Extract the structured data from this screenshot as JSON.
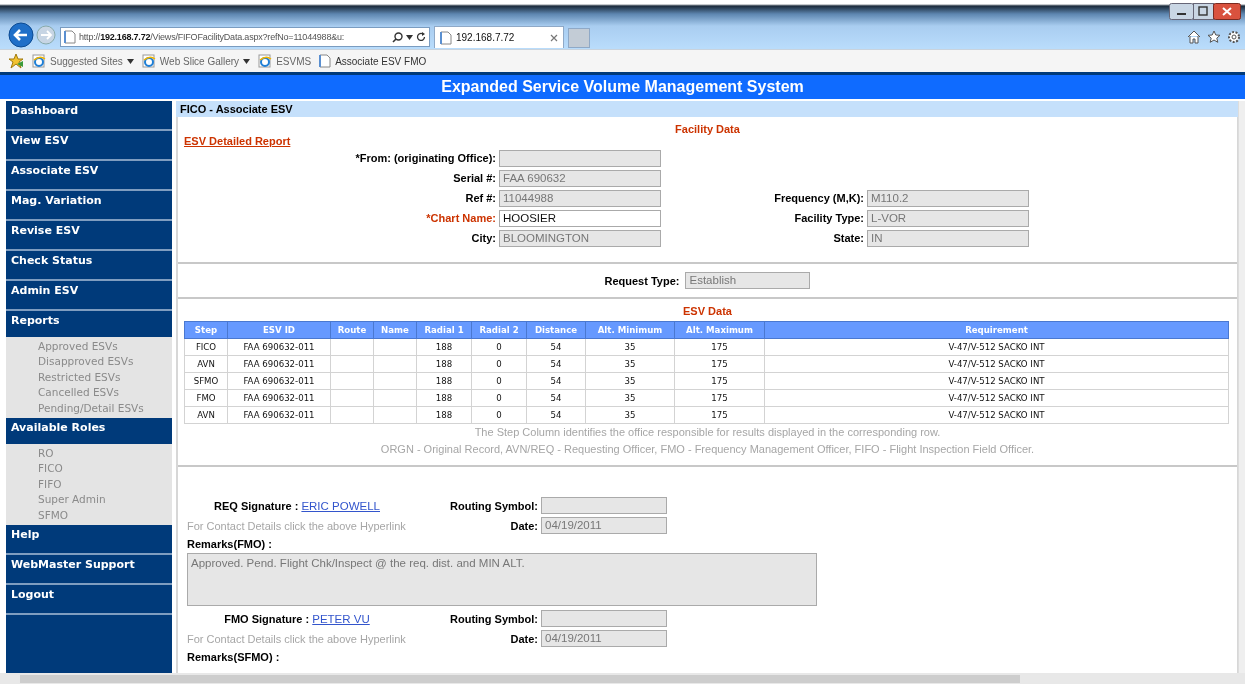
{
  "browser": {
    "address": "http://**192.168.7.72**/Views/FIFOFacilityData.aspx?refNo=11044988&u:",
    "tab_title": "192.168.7.72",
    "favorites": [
      {
        "label": "Suggested Sites",
        "kind": "ie",
        "dropdown": true
      },
      {
        "label": "Web Slice Gallery",
        "kind": "ie",
        "dropdown": true
      },
      {
        "label": "ESVMS",
        "kind": "ie",
        "dropdown": false
      },
      {
        "label": "Associate ESV FMO",
        "kind": "page",
        "dropdown": false
      }
    ]
  },
  "header": {
    "title": "Expanded Service Volume Management System"
  },
  "sidebar": {
    "items": [
      {
        "label": "Dashboard"
      },
      {
        "label": "View ESV"
      },
      {
        "label": "Associate ESV"
      },
      {
        "label": "Mag. Variation"
      },
      {
        "label": "Revise ESV"
      },
      {
        "label": "Check Status"
      },
      {
        "label": "Admin ESV"
      },
      {
        "label": "Reports",
        "children": [
          {
            "label": "Approved ESVs"
          },
          {
            "label": "Disapproved ESVs"
          },
          {
            "label": "Restricted ESVs"
          },
          {
            "label": "Cancelled ESVs"
          },
          {
            "label": "Pending/Detail ESVs"
          }
        ]
      },
      {
        "label": "Available Roles",
        "children": [
          {
            "label": "RO"
          },
          {
            "label": "FICO"
          },
          {
            "label": "FIFO"
          },
          {
            "label": "Super Admin"
          },
          {
            "label": "SFMO"
          }
        ]
      },
      {
        "label": "Help"
      },
      {
        "label": "WebMaster Support"
      },
      {
        "label": "Logout"
      }
    ]
  },
  "page_title": "FICO - Associate ESV",
  "facility": {
    "heading": "Facility Data",
    "report_link": "ESV Detailed Report",
    "left_fields": [
      {
        "label": "*From: (originating Office):",
        "kind": "readonly"
      },
      {
        "label": "Serial #:",
        "value": "FAA 690632",
        "kind": "readonly"
      },
      {
        "label": "Ref #:",
        "value": "11044988",
        "kind": "readonly"
      },
      {
        "label": "*Chart Name:",
        "value": "HOOSIER",
        "kind": "editable"
      },
      {
        "label": "City:",
        "value": "BLOOMINGTON",
        "kind": "readonly"
      }
    ],
    "right_fields": [
      {
        "label": "Frequency (M,K):",
        "value": "M110.2",
        "kind": "readonly"
      },
      {
        "label": "Facility Type:",
        "value": "L-VOR",
        "kind": "readonly"
      },
      {
        "label": "State:",
        "value": "IN",
        "kind": "readonly"
      }
    ]
  },
  "request_type": {
    "label": "Request Type:",
    "value": "Establish"
  },
  "esv_data": {
    "heading": "ESV Data",
    "columns": [
      "Step",
      "ESV ID",
      "Route",
      "Name",
      "Radial 1",
      "Radial 2",
      "Distance",
      "Alt. Minimum",
      "Alt. Maximum",
      "Requirement"
    ],
    "rows": [
      [
        "FICO",
        "FAA 690632-011",
        null,
        null,
        "188",
        "0",
        "54",
        "35",
        "175",
        "V-47/V-512 SACKO INT"
      ],
      [
        "AVN",
        "FAA 690632-011",
        null,
        null,
        "188",
        "0",
        "54",
        "35",
        "175",
        "V-47/V-512 SACKO INT"
      ],
      [
        "SFMO",
        "FAA 690632-011",
        null,
        null,
        "188",
        "0",
        "54",
        "35",
        "175",
        "V-47/V-512 SACKO INT"
      ],
      [
        "FMO",
        "FAA 690632-011",
        null,
        null,
        "188",
        "0",
        "54",
        "35",
        "175",
        "V-47/V-512 SACKO INT"
      ],
      [
        "AVN",
        "FAA 690632-011",
        null,
        null,
        "188",
        "0",
        "54",
        "35",
        "175",
        "V-47/V-512 SACKO INT"
      ]
    ],
    "notes": [
      "The Step Column identifies the office responsible for results displayed in the corresponding row.",
      "ORGN - Original Record, AVN/REQ - Requesting Officer, FMO - Frequency Management Officer, FIFO - Flight Inspection Field Officer."
    ]
  },
  "signatures": [
    {
      "label": "REQ Signature :",
      "name": "ERIC POWELL",
      "hint": "For Contact Details click the above Hyperlink",
      "routing_label": "Routing Symbol:",
      "date_label": "Date:",
      "date": "04/19/2011",
      "remarks_label": "Remarks(FMO) :",
      "remarks": "Approved. Pend. Flight Chk/Inspect @ the req. dist. and MIN ALT."
    },
    {
      "label": "FMO Signature :",
      "name": "PETER VU",
      "hint": "For Contact Details click the above Hyperlink",
      "routing_label": "Routing Symbol:",
      "date_label": "Date:",
      "date": "04/19/2011",
      "remarks_label": "Remarks(SFMO) :"
    }
  ]
}
